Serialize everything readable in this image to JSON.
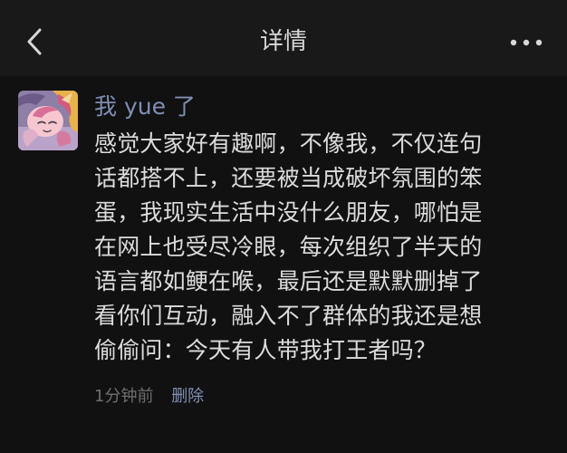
{
  "header": {
    "title": "详情",
    "back_icon": "chevron-left-icon",
    "more_icon": "more-horizontal-icon"
  },
  "post": {
    "author": "我 yue 了",
    "avatar_icon": "cartoon-pony-avatar",
    "lines": [
      "感觉大家好有趣啊，不像我，不仅连句",
      "话都搭不上，还要被当成破坏氛围的笨",
      "蛋，我现实生活中没什么朋友，哪怕是",
      "在网上也受尽冷眼，每次组织了半天的",
      "语言都如鲠在喉，最后还是默默删掉了",
      "看你们互动，融入不了群体的我还是想",
      "偷偷问：今天有人带我打王者吗？"
    ],
    "time": "1分钟前",
    "delete_label": "删除"
  },
  "colors": {
    "background": "#111111",
    "navbar": "#191919",
    "text": "#dcdcdc",
    "link": "#7f8fb4",
    "muted": "#6f6f6f"
  }
}
